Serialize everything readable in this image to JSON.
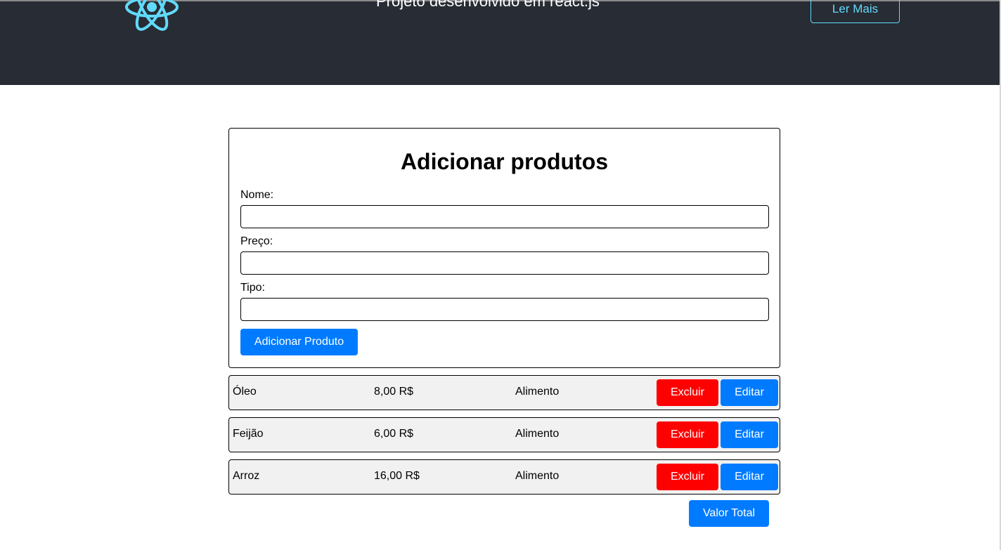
{
  "header": {
    "title": "Projeto desenvolvido em react.js",
    "read_more_label": "Ler Mais",
    "logo_icon": "react-atom-icon",
    "accent_color": "#61dafb",
    "background_color": "#282c34"
  },
  "form": {
    "title": "Adicionar produtos",
    "fields": [
      {
        "label": "Nome:",
        "value": "",
        "placeholder": ""
      },
      {
        "label": "Preço:",
        "value": "",
        "placeholder": ""
      },
      {
        "label": "Tipo:",
        "value": "",
        "placeholder": ""
      }
    ],
    "submit_label": "Adicionar Produto"
  },
  "products": [
    {
      "name": "Óleo",
      "price": "8,00 R$",
      "type": "Alimento",
      "delete_label": "Excluir",
      "edit_label": "Editar"
    },
    {
      "name": "Feijão",
      "price": "6,00 R$",
      "type": "Alimento",
      "delete_label": "Excluir",
      "edit_label": "Editar"
    },
    {
      "name": "Arroz",
      "price": "16,00 R$",
      "type": "Alimento",
      "delete_label": "Excluir",
      "edit_label": "Editar"
    }
  ],
  "total_button_label": "Valor Total",
  "colors": {
    "primary": "#007bff",
    "danger": "#ff0000",
    "row_background": "#f1f1f1"
  }
}
